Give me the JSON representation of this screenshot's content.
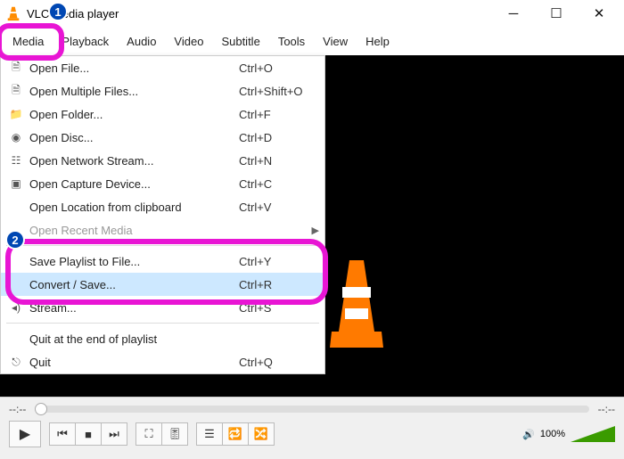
{
  "window": {
    "title": "VLC media player"
  },
  "menubar": {
    "items": [
      "Media",
      "Playback",
      "Audio",
      "Video",
      "Subtitle",
      "Tools",
      "View",
      "Help"
    ]
  },
  "dropdown": {
    "items": [
      {
        "label": "Open File...",
        "shortcut": "Ctrl+O",
        "icon": "file"
      },
      {
        "label": "Open Multiple Files...",
        "shortcut": "Ctrl+Shift+O",
        "icon": "files"
      },
      {
        "label": "Open Folder...",
        "shortcut": "Ctrl+F",
        "icon": "folder"
      },
      {
        "label": "Open Disc...",
        "shortcut": "Ctrl+D",
        "icon": "disc"
      },
      {
        "label": "Open Network Stream...",
        "shortcut": "Ctrl+N",
        "icon": "network"
      },
      {
        "label": "Open Capture Device...",
        "shortcut": "Ctrl+C",
        "icon": "capture"
      },
      {
        "label": "Open Location from clipboard",
        "shortcut": "Ctrl+V",
        "icon": ""
      },
      {
        "label": "Open Recent Media",
        "shortcut": "",
        "icon": "",
        "submenu": true,
        "disabled": true
      }
    ],
    "items2": [
      {
        "label": "Save Playlist to File...",
        "shortcut": "Ctrl+Y",
        "icon": ""
      },
      {
        "label": "Convert / Save...",
        "shortcut": "Ctrl+R",
        "icon": "",
        "highlight": true
      },
      {
        "label": "Stream...",
        "shortcut": "Ctrl+S",
        "icon": "stream"
      }
    ],
    "items3": [
      {
        "label": "Quit at the end of playlist",
        "shortcut": "",
        "icon": ""
      },
      {
        "label": "Quit",
        "shortcut": "Ctrl+Q",
        "icon": "quit"
      }
    ]
  },
  "annotations": {
    "bubble1": "1",
    "bubble2": "2"
  },
  "controls": {
    "time_current": "--:--",
    "time_total": "--:--",
    "volume_text": "100%"
  }
}
